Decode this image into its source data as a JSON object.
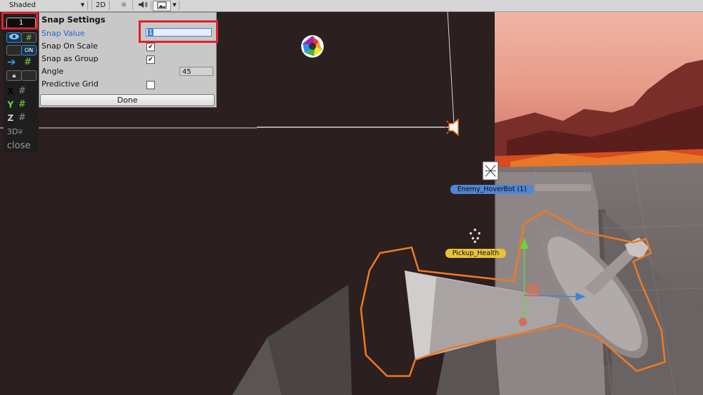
{
  "toolbar": {
    "shading_mode": "Shaded",
    "view_2d_label": "2D",
    "lighting_icon": "sun-icon",
    "audio_icon": "speaker-icon",
    "effects_icon": "image-icon"
  },
  "left_panel": {
    "snap_value_display": "1",
    "visibility_toggle": "ON",
    "axes": [
      {
        "label": "X",
        "color": "#d0d0d0"
      },
      {
        "label": "Y",
        "color": "#6bd33e"
      },
      {
        "label": "Z",
        "color": "#d0d0d0"
      }
    ],
    "mode_3d": "3D",
    "close_label": "close"
  },
  "snap_dialog": {
    "title": "Snap Settings",
    "snap_value_label": "Snap Value",
    "snap_value": "1",
    "snap_on_scale_label": "Snap On Scale",
    "snap_on_scale": true,
    "snap_as_group_label": "Snap as Group",
    "snap_as_group": true,
    "angle_label": "Angle",
    "angle_value": "45",
    "predictive_grid_label": "Predictive Grid",
    "predictive_grid": false,
    "done_label": "Done"
  },
  "scene_labels": {
    "enemy": "Enemy_HoverBot (1)",
    "pickup": "Pickup_Health"
  },
  "colors": {
    "highlight": "#e0202a",
    "selection_outline": "#f07a20",
    "sky": "#e5a08e"
  }
}
